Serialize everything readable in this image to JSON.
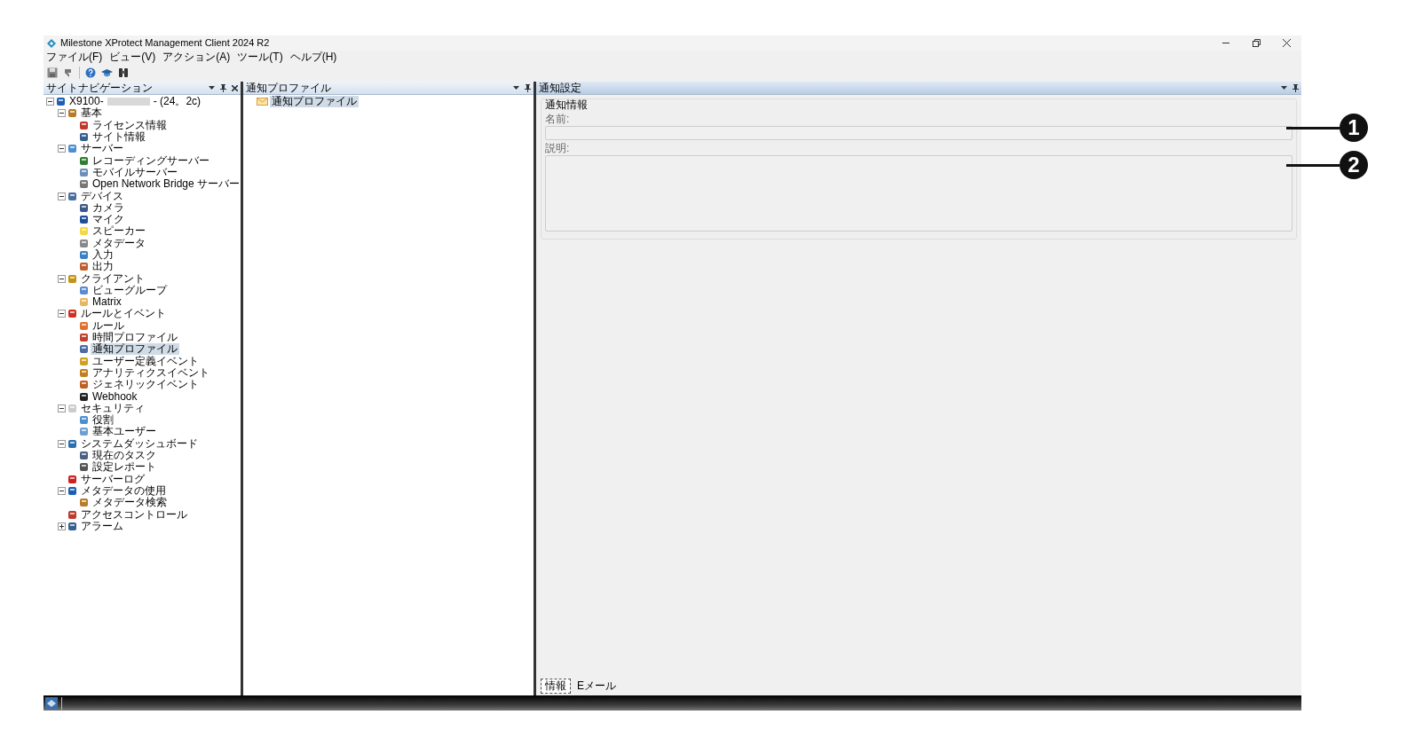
{
  "window": {
    "title": "Milestone XProtect Management Client 2024 R2"
  },
  "menu": [
    "ファイル(F)",
    "ビュー(V)",
    "アクション(A)",
    "ツール(T)",
    "ヘルプ(H)"
  ],
  "site_navigation": {
    "title": "サイトナビゲーション",
    "tree": [
      {
        "label": "X9100-",
        "label_suffix": "- (24。2c)",
        "expanded": true,
        "children": [
          {
            "label": "基本",
            "expanded": true,
            "children": [
              {
                "label": "ライセンス情報",
                "selected": false
              },
              {
                "label": "サイト情報",
                "selected": false
              }
            ],
            "selected": false
          },
          {
            "label": "サーバー",
            "expanded": true,
            "children": [
              {
                "label": "レコーディングサーバー",
                "selected": false
              },
              {
                "label": "モバイルサーバー",
                "selected": false
              },
              {
                "label": "Open Network Bridge サーバー",
                "selected": false
              }
            ],
            "selected": false
          },
          {
            "label": "デバイス",
            "expanded": true,
            "children": [
              {
                "label": "カメラ",
                "selected": false
              },
              {
                "label": "マイク",
                "selected": false
              },
              {
                "label": "スピーカー",
                "selected": false
              },
              {
                "label": "メタデータ",
                "selected": false
              },
              {
                "label": "入力",
                "selected": false
              },
              {
                "label": "出力",
                "selected": false
              }
            ],
            "selected": false
          },
          {
            "label": "クライアント",
            "expanded": true,
            "children": [
              {
                "label": "ビューグループ",
                "selected": false
              },
              {
                "label": "Matrix",
                "selected": false
              }
            ],
            "selected": false
          },
          {
            "label": "ルールとイベント",
            "expanded": true,
            "children": [
              {
                "label": "ルール",
                "selected": false
              },
              {
                "label": "時間プロファイル",
                "selected": false
              },
              {
                "label": "通知プロファイル",
                "selected": true
              },
              {
                "label": "ユーザー定義イベント",
                "selected": false
              },
              {
                "label": "アナリティクスイベント",
                "selected": false
              },
              {
                "label": "ジェネリックイベント",
                "selected": false
              },
              {
                "label": "Webhook",
                "selected": false
              }
            ],
            "selected": false
          },
          {
            "label": "セキュリティ",
            "expanded": true,
            "children": [
              {
                "label": "役割",
                "selected": false
              },
              {
                "label": "基本ユーザー",
                "selected": false
              }
            ],
            "selected": false
          },
          {
            "label": "システムダッシュボード",
            "expanded": true,
            "children": [
              {
                "label": "現在のタスク",
                "selected": false
              },
              {
                "label": "設定レポート",
                "selected": false
              }
            ],
            "selected": false
          },
          {
            "label": "サーバーログ",
            "selected": false
          },
          {
            "label": "メタデータの使用",
            "expanded": true,
            "children": [
              {
                "label": "メタデータ検索",
                "selected": false
              }
            ],
            "selected": false
          },
          {
            "label": "アクセスコントロール",
            "selected": false
          },
          {
            "label": "アラーム",
            "expanded": false,
            "selected": false
          }
        ],
        "selected": false
      }
    ]
  },
  "profiles_panel": {
    "title": "通知プロファイル",
    "items": [
      {
        "label": "通知プロファイル",
        "selected": true
      }
    ]
  },
  "settings_panel": {
    "title": "通知設定",
    "group": "通知情報",
    "name_label": "名前:",
    "description_label": "説明:",
    "tabs": [
      {
        "label": "情報",
        "selected": true
      },
      {
        "label": "Eメール",
        "selected": false
      }
    ]
  },
  "callouts": [
    "1",
    "2"
  ]
}
